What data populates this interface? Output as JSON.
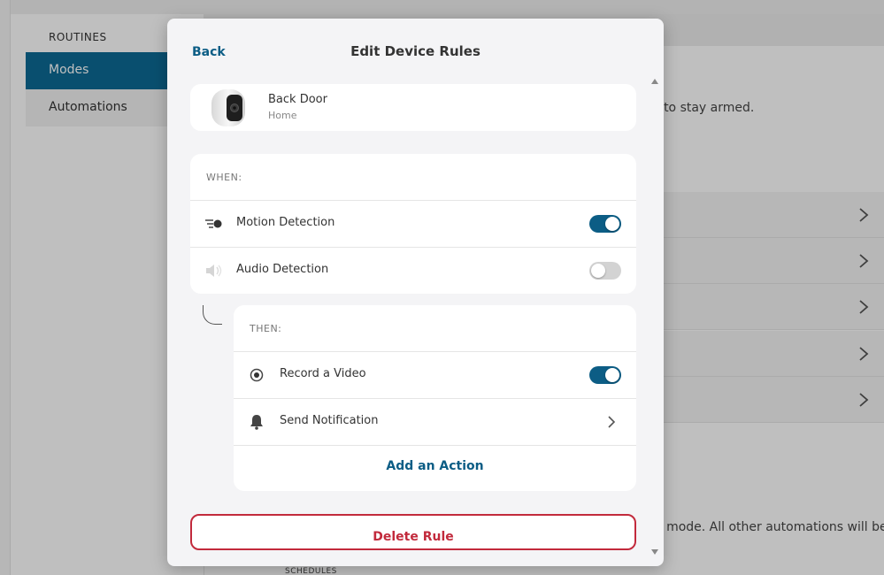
{
  "background": {
    "sidebar": {
      "section_title": "ROUTINES",
      "items": [
        {
          "label": "Modes",
          "active": true
        },
        {
          "label": "Automations",
          "active": false
        }
      ]
    },
    "main": {
      "partial_text_1": "e to stay armed.",
      "partial_text_2": "e mode. All other automations will be",
      "schedules_label": "SCHEDULES",
      "row_count": 5
    }
  },
  "modal": {
    "back_label": "Back",
    "title": "Edit Device Rules",
    "device": {
      "name": "Back Door",
      "location": "Home",
      "icon": "camera-icon"
    },
    "when": {
      "label": "WHEN:",
      "triggers": [
        {
          "label": "Motion Detection",
          "icon": "motion-icon",
          "enabled": true
        },
        {
          "label": "Audio Detection",
          "icon": "speaker-icon",
          "enabled": false
        }
      ]
    },
    "then": {
      "label": "THEN:",
      "actions": [
        {
          "label": "Record a Video",
          "icon": "record-icon",
          "enabled": true
        },
        {
          "label": "Send Notification",
          "icon": "bell-icon",
          "chevron": true
        }
      ],
      "add_action_label": "Add an Action"
    },
    "delete_label": "Delete Rule"
  },
  "colors": {
    "accent": "#0c5d85",
    "sidebar_active": "#0c6a95",
    "danger": "#c22a3c",
    "toggle_off": "#d3d3d3"
  }
}
